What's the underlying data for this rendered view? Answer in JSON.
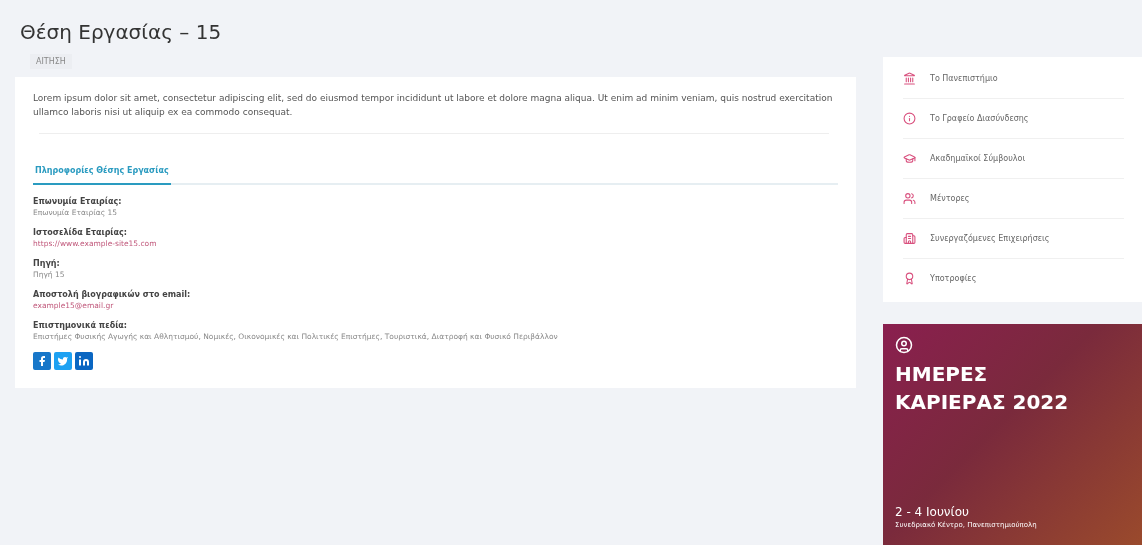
{
  "page_title": "Θέση Εργασίας – 15",
  "breadcrumb": "ΑΙΤΗΣΗ",
  "description": "Lorem ipsum dolor sit amet, consectetur adipiscing elit, sed do eiusmod tempor incididunt ut labore et dolore magna aliqua. Ut enim ad minim veniam, quis nostrud exercitation ullamco laboris nisi ut aliquip ex ea commodo consequat.",
  "tabs": [
    {
      "label": "Πληροφορίες Θέσης Εργασίας",
      "selected": true
    }
  ],
  "fields": [
    {
      "label": "Επωνυμία Εταιρίας:",
      "value": "Επωνυμία Εταιρίας 15",
      "kind": "text"
    },
    {
      "label": "Ιστοσελίδα Εταιρίας:",
      "value": "https://www.example-site15.com",
      "kind": "link"
    },
    {
      "label": "Πηγή:",
      "value": "Πηγή 15",
      "kind": "text"
    },
    {
      "label": "Αποστολή βιογραφικών στο email:",
      "value": "example15@email.gr",
      "kind": "link"
    },
    {
      "label": "Επιστημονικά πεδία:",
      "value": "Επιστήμες Φυσικής Αγωγής και Αθλητισμού, Νομικές, Οικονομικές και Πολιτικές Επιστήμες, Τουριστικά, Διατροφή και Φυσικό Περιβάλλον",
      "kind": "text"
    }
  ],
  "share": [
    {
      "kind": "facebook"
    },
    {
      "kind": "twitter"
    },
    {
      "kind": "linkedin"
    }
  ],
  "sidebar": {
    "items": [
      {
        "label": "Το Πανεπιστήμιο",
        "kind": "university"
      },
      {
        "label": "Το Γραφείο Διασύνδεσης",
        "kind": "info"
      },
      {
        "label": "Ακαδημαϊκοί Σύμβουλοι",
        "kind": "graduation"
      },
      {
        "label": "Μέντορες",
        "kind": "users"
      },
      {
        "label": "Συνεργαζόμενες Επιχειρήσεις",
        "kind": "building"
      },
      {
        "label": "Υποτροφίες",
        "kind": "award"
      }
    ]
  },
  "banner": {
    "title_lines": [
      "ΗΜΕΡΕΣ",
      "ΚΑΡΙΕΡΑΣ 2022"
    ],
    "date": "2 - 4 Ιουνίου",
    "venue": "Συνεδριακό Κέντρο, Πανεπιστημιούπολη"
  }
}
